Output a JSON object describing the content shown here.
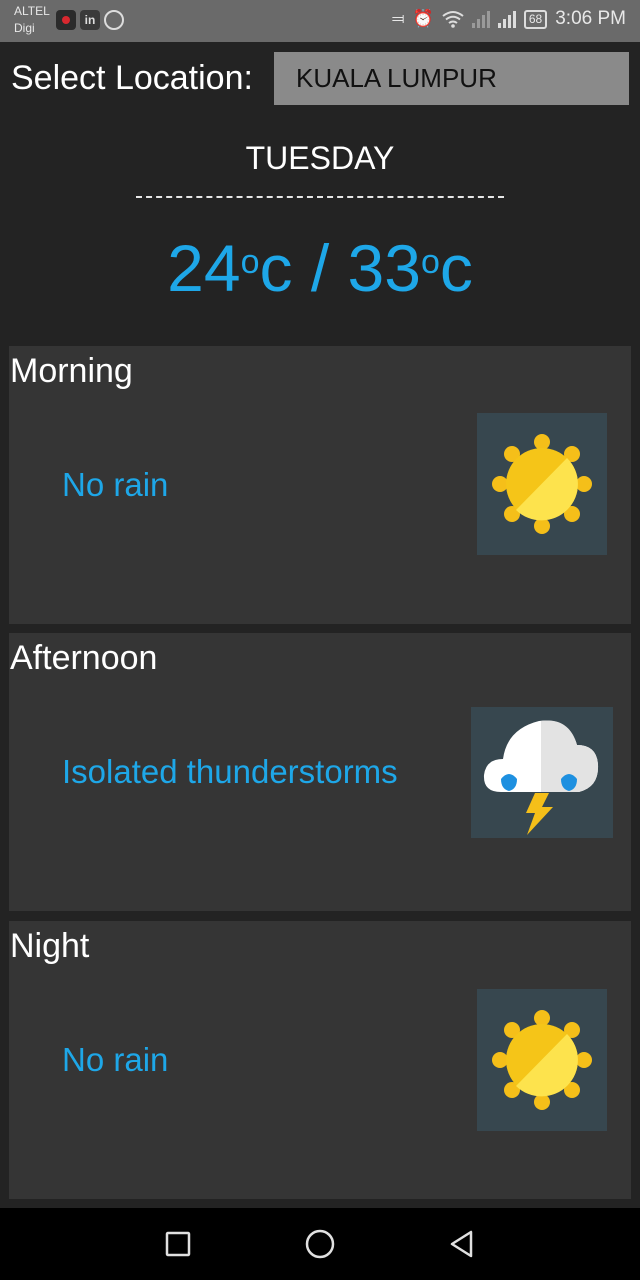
{
  "status_bar": {
    "carrier_1": "ALTEL",
    "carrier_2": "Digi",
    "battery": "68",
    "time": "3:06 PM",
    "app_icons": [
      "screen-record-icon",
      "linkedin-icon",
      "whatsapp-icon"
    ],
    "system_icons": [
      "vibrate-icon",
      "alarm-icon",
      "wifi-icon",
      "signal-icon",
      "signal-icon"
    ]
  },
  "location": {
    "label": "Select Location:",
    "selected": "KUALA LUMPUR"
  },
  "forecast": {
    "day": "TUESDAY",
    "divider": "-------------------------------------------------",
    "min_temp": "24",
    "max_temp": "33",
    "degree_symbol": "o",
    "unit": "c",
    "separator": "/"
  },
  "periods": [
    {
      "title": "Morning",
      "description": "No rain",
      "icon": "sun-icon"
    },
    {
      "title": "Afternoon",
      "description": "Isolated thunderstorms",
      "icon": "thunderstorm-icon"
    },
    {
      "title": "Night",
      "description": "No rain",
      "icon": "sun-icon"
    }
  ],
  "colors": {
    "accent": "#1ea7e8",
    "background": "#232323",
    "card": "#353535",
    "icon_tile": "#37474f"
  },
  "nav_bar": {
    "buttons": [
      "recent-apps-icon",
      "home-icon",
      "back-icon"
    ]
  }
}
